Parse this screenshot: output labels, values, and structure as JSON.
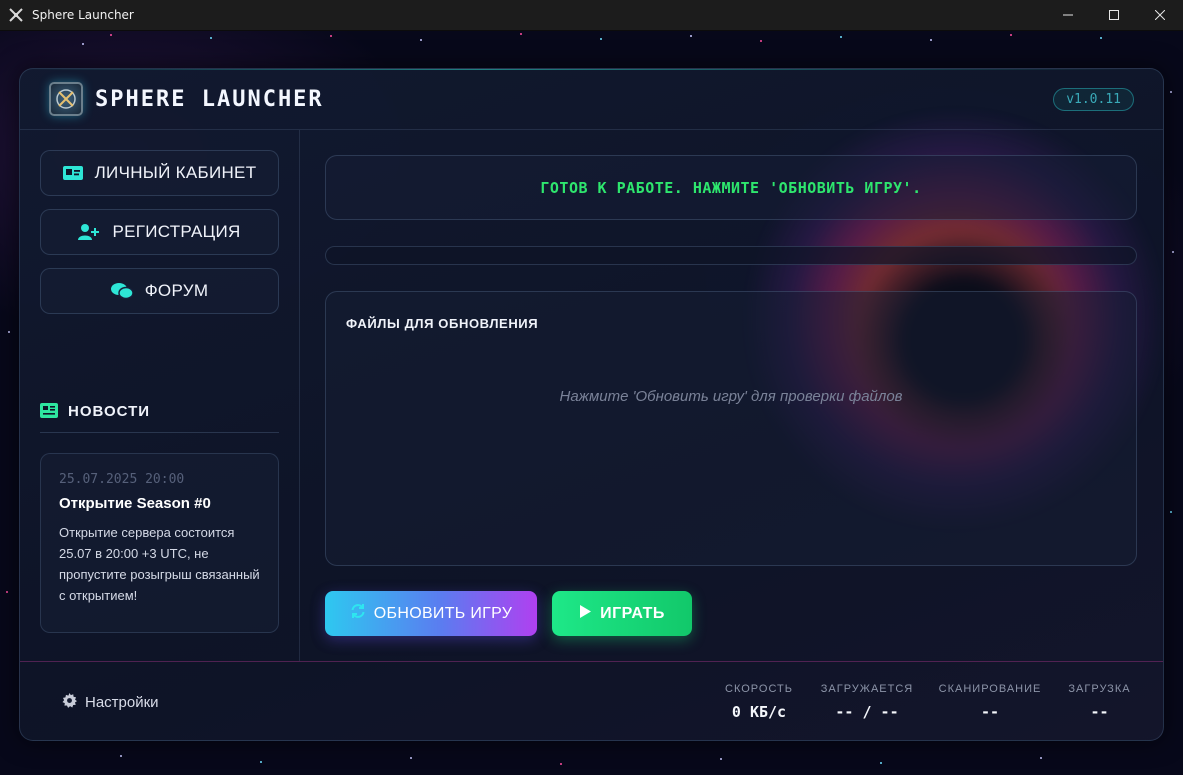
{
  "window": {
    "title": "Sphere Launcher",
    "icon": "crossed-swords-icon",
    "controls": [
      "minimize-icon",
      "maximize-icon",
      "close-icon"
    ]
  },
  "header": {
    "brand": "SPHERE LAUNCHER",
    "version": "v1.0.11"
  },
  "sidebar": {
    "nav": [
      {
        "label": "ЛИЧНЫЙ КАБИНЕТ",
        "icon": "id-card-icon"
      },
      {
        "label": "РЕГИСТРАЦИЯ",
        "icon": "user-plus-icon"
      },
      {
        "label": "ФОРУМ",
        "icon": "comments-icon"
      }
    ],
    "news_title": "НОВОСТИ",
    "news": [
      {
        "date": "25.07.2025 20:00",
        "title": "Открытие Season #0",
        "text": "Открытие сервера состоится 25.07 в 20:00 +3 UTC, не пропустите розыгрыш связанный с открытием!"
      }
    ]
  },
  "main": {
    "status": "ГОТОВ К РАБОТЕ. НАЖМИТЕ 'ОБНОВИТЬ ИГРУ'.",
    "progress": 0,
    "files_title": "ФАЙЛЫ ДЛЯ ОБНОВЛЕНИЯ",
    "files_hint": "Нажмите 'Обновить игру' для проверки файлов",
    "update_label": "ОБНОВИТЬ ИГРУ",
    "play_label": "ИГРАТЬ"
  },
  "footer": {
    "settings_label": "Настройки",
    "stats": [
      {
        "label": "СКОРОСТЬ",
        "value": "0 КБ/с"
      },
      {
        "label": "ЗАГРУЖАЕТСЯ",
        "value": "-- / --"
      },
      {
        "label": "СКАНИРОВАНИЕ",
        "value": "--"
      },
      {
        "label": "ЗАГРУЗКА",
        "value": "--"
      }
    ]
  },
  "colors": {
    "accent_cyan": "#2ee6d6",
    "status_green": "#2ee66e",
    "play_green": "#1ee888",
    "update_gradient_start": "#2ec8f0",
    "update_gradient_end": "#b040f0"
  }
}
